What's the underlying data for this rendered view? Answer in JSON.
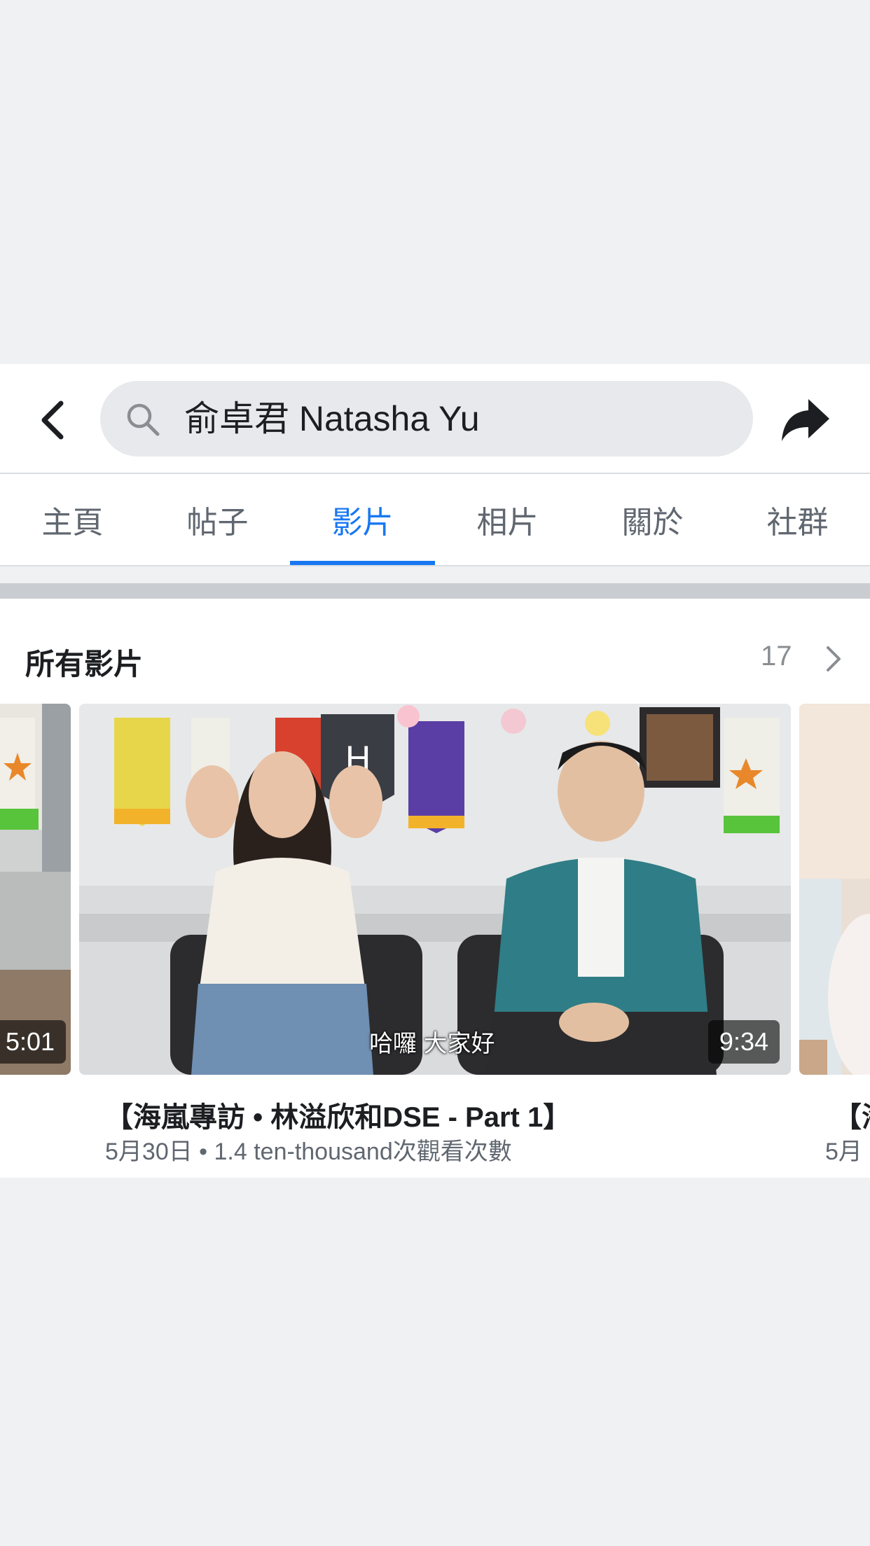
{
  "header": {
    "search_text": "俞卓君 Natasha Yu"
  },
  "tabs": [
    {
      "label": "主頁",
      "active": false
    },
    {
      "label": "帖子",
      "active": false
    },
    {
      "label": "影片",
      "active": true
    },
    {
      "label": "相片",
      "active": false
    },
    {
      "label": "關於",
      "active": false
    },
    {
      "label": "社群",
      "active": false
    }
  ],
  "section": {
    "title": "所有影片",
    "count": "17"
  },
  "videos": {
    "prev": {
      "duration": "5:01"
    },
    "main": {
      "duration": "9:34",
      "subtitle": "哈囉  大家好",
      "title": "【海嵐專訪 • 林溢欣和DSE - Part 1】",
      "meta": "5月30日 • 1.4 ten-thousand次觀看次數"
    },
    "next": {
      "title_fragment": "【海",
      "meta_fragment": "5月"
    }
  },
  "colors": {
    "accent": "#1877f2",
    "background": "#f0f1f3",
    "text_primary": "#1c1e21",
    "text_secondary": "#606770"
  }
}
